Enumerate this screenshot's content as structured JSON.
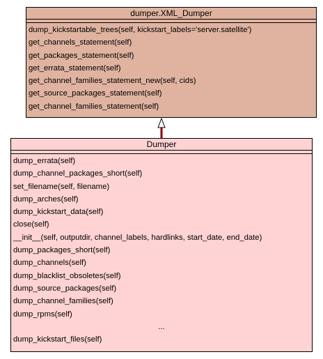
{
  "parent_class": {
    "name": "dumper.XML_Dumper",
    "attributes": [],
    "methods": [
      "dump_kickstartable_trees(self, kickstart_labels='server.satellite')",
      "get_channels_statement(self)",
      "get_packages_statement(self)",
      "get_errata_statement(self)",
      "get_channel_families_statement_new(self, cids)",
      "get_source_packages_statement(self)",
      "get_channel_families_statement(self)"
    ],
    "color": "#e0b3a0"
  },
  "child_class": {
    "name": "Dumper",
    "attributes": [],
    "methods": [
      "dump_errata(self)",
      "dump_channel_packages_short(self)",
      "set_filename(self, filename)",
      "dump_arches(self)",
      "dump_kickstart_data(self)",
      "close(self)",
      "__init__(self, outputdir, channel_labels, hardlinks, start_date, end_date)",
      "dump_packages_short(self)",
      "dump_channels(self)",
      "dump_blacklist_obsoletes(self)",
      "dump_source_packages(self)",
      "dump_channel_families(self)",
      "dump_rpms(self)",
      "...",
      "dump_kickstart_files(self)"
    ],
    "color": "#ffd3d3"
  },
  "relation": {
    "type": "inheritance",
    "from": "Dumper",
    "to": "dumper.XML_Dumper",
    "color": "#8b0000"
  }
}
